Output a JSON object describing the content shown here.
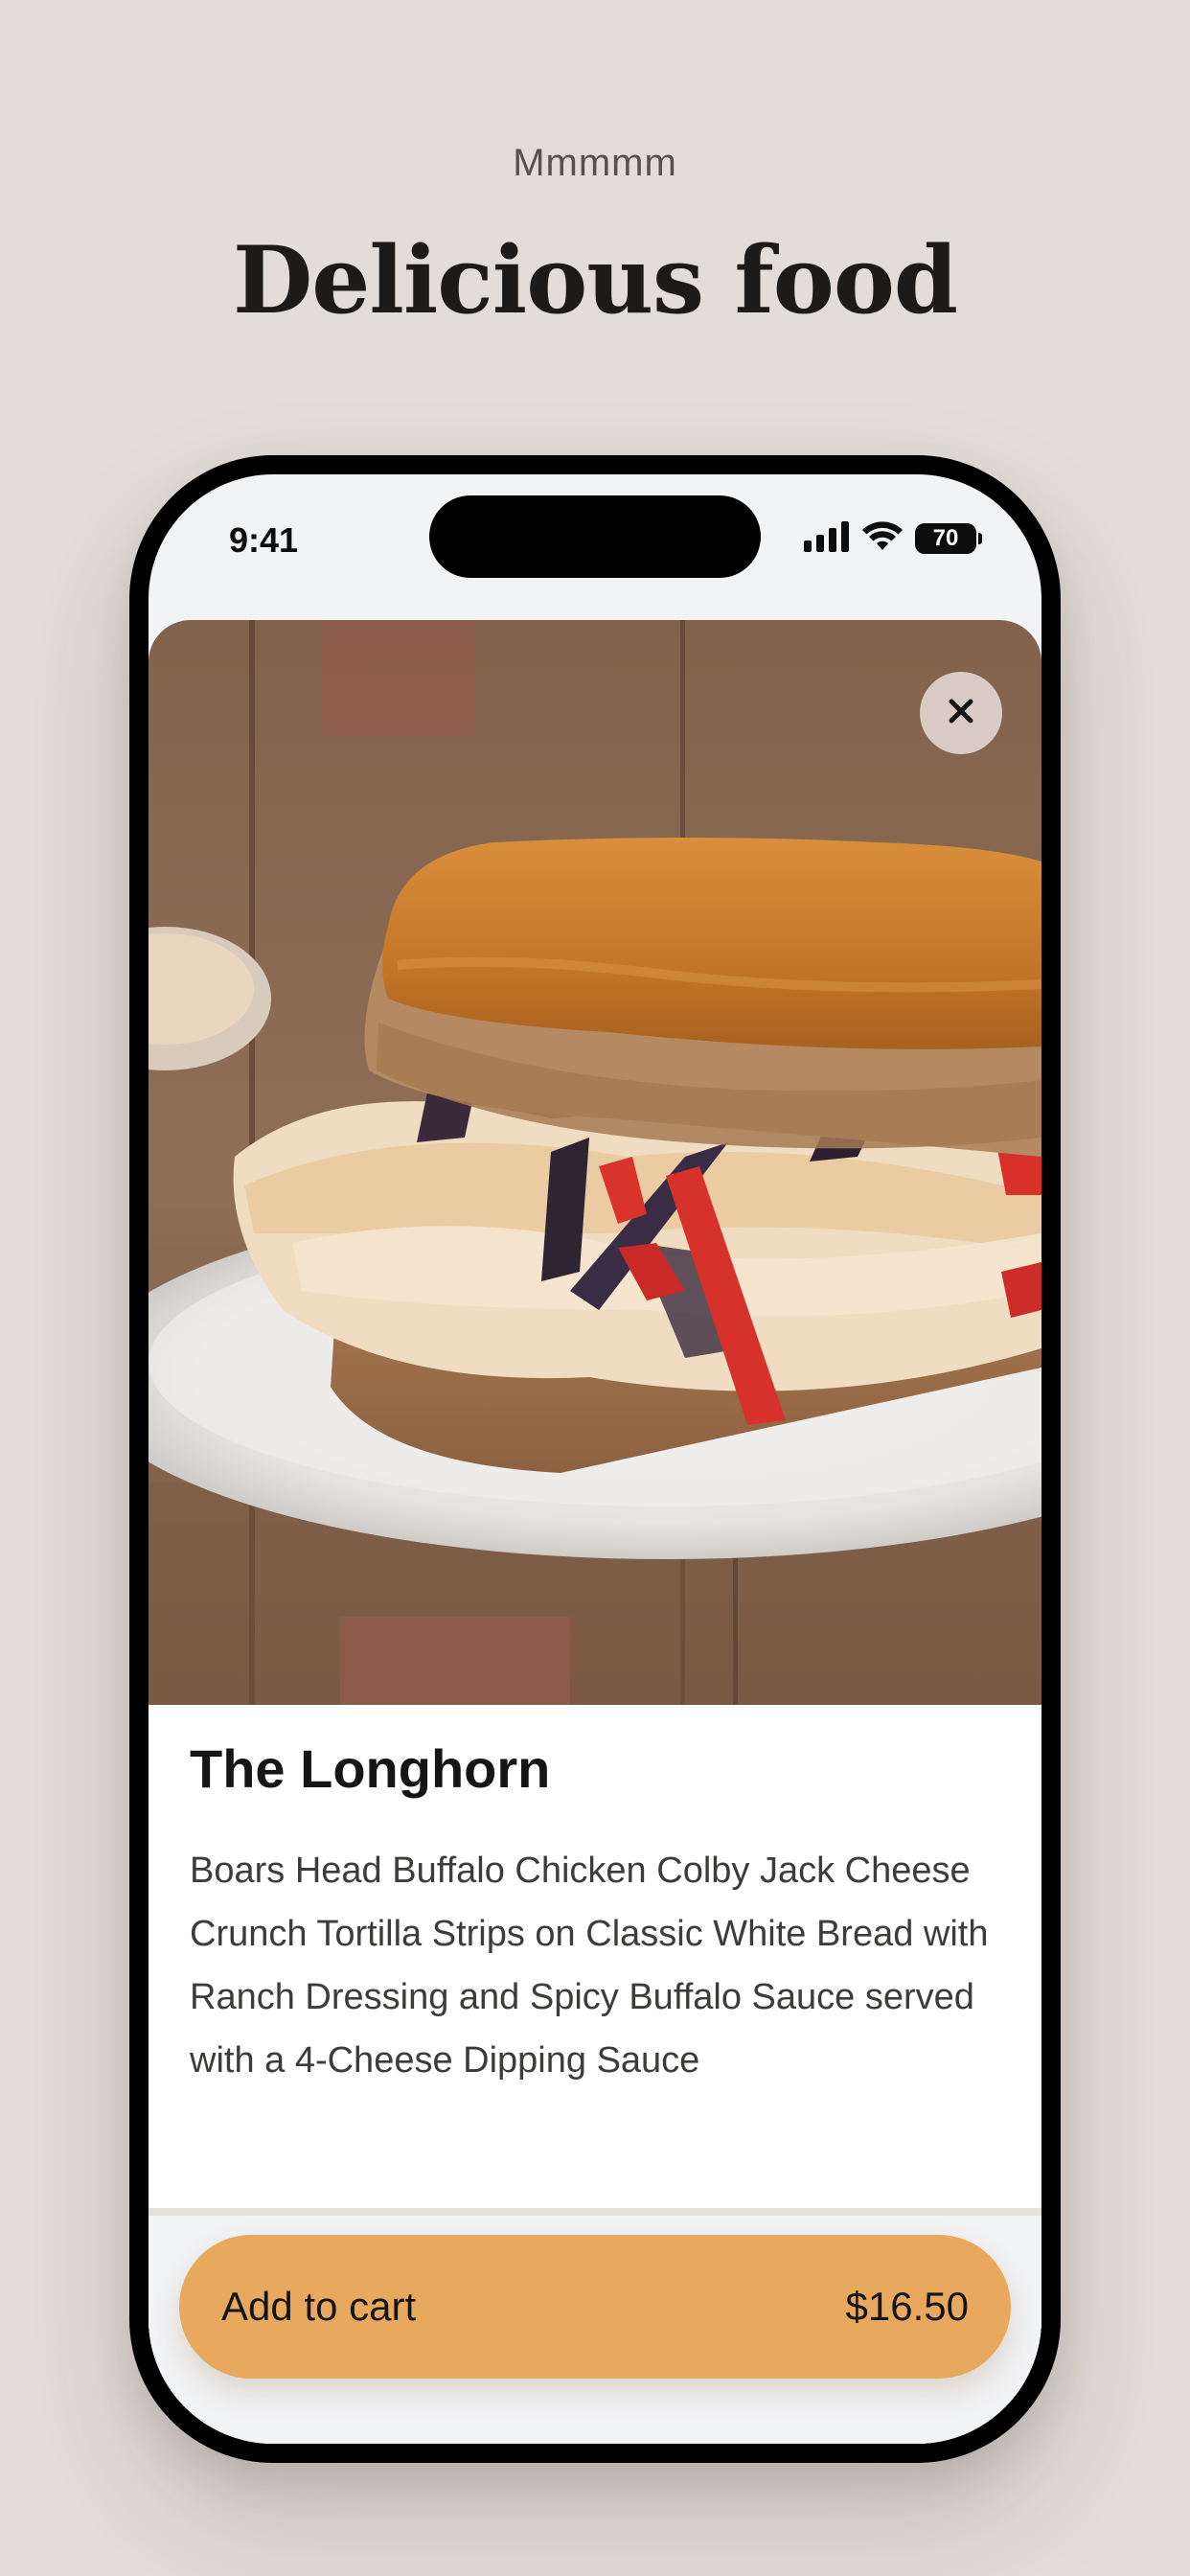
{
  "page": {
    "eyebrow": "Mmmmm",
    "headline": "Delicious food"
  },
  "status_bar": {
    "time": "9:41",
    "battery": "70",
    "icons": [
      "cellular-signal-icon",
      "wifi-icon",
      "battery-icon"
    ]
  },
  "product": {
    "image": "sandwich-photo",
    "title": "The Longhorn",
    "description": "Boars Head Buffalo Chicken Colby Jack Cheese Crunch Tortilla Strips on Classic White Bread with Ranch Dressing and Spicy Buffalo Sauce served with a 4-Cheese Dipping Sauce",
    "close_icon": "close-icon"
  },
  "cart": {
    "label": "Add to cart",
    "price": "$16.50"
  },
  "colors": {
    "background": "#e2ddd8",
    "accent": "#e8a85e",
    "text": "#151515"
  }
}
